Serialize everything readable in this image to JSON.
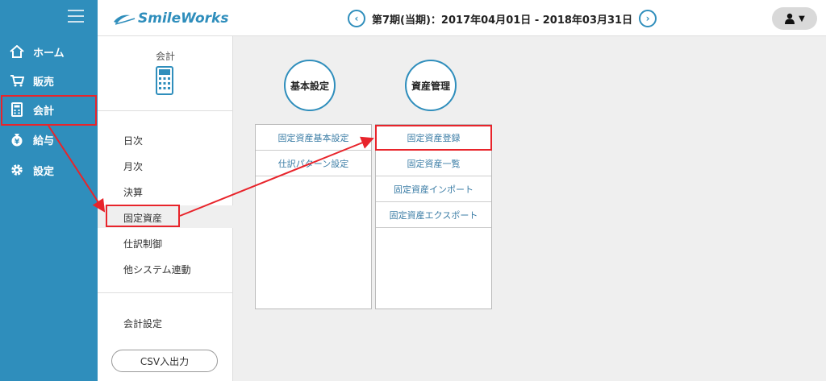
{
  "nav": {
    "items": [
      {
        "label": "ホーム"
      },
      {
        "label": "販売"
      },
      {
        "label": "会計"
      },
      {
        "label": "給与"
      },
      {
        "label": "設定"
      }
    ]
  },
  "header": {
    "logo": "SmileWorks",
    "period": "第7期(当期)：2017年04月01日 - 2018年03月31日"
  },
  "sub": {
    "title": "会計",
    "items": [
      "日次",
      "月次",
      "決算",
      "固定資産",
      "仕訳制御",
      "他システム連動",
      "会計設定"
    ],
    "csv": "CSV入出力"
  },
  "main": {
    "basic": {
      "title": "基本設定",
      "items": [
        "固定資産基本設定",
        "仕訳パターン設定"
      ]
    },
    "asset": {
      "title": "資産管理",
      "items": [
        "固定資産登録",
        "固定資産一覧",
        "固定資産インポート",
        "固定資産エクスポート"
      ]
    }
  },
  "colors": {
    "accent": "#2f8ebc",
    "highlight": "#e8242b"
  }
}
